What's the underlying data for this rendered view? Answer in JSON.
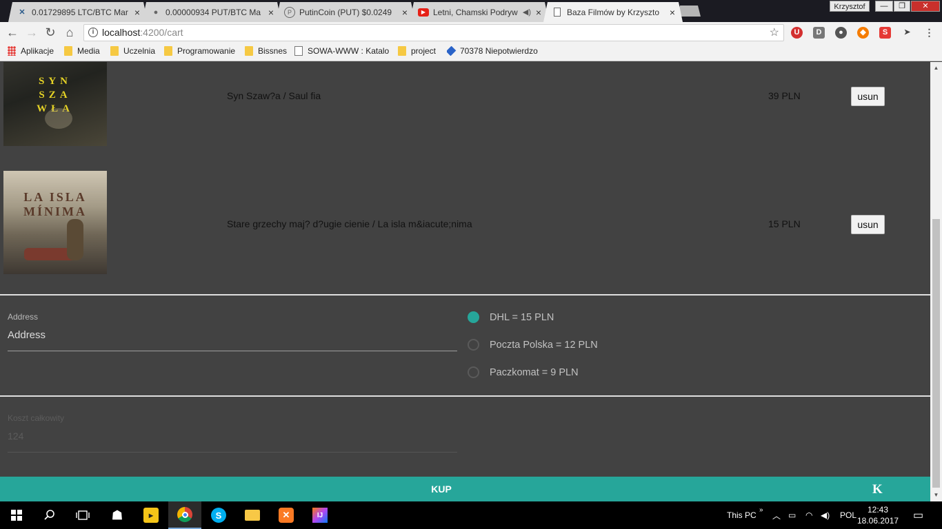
{
  "browser": {
    "tabs": [
      {
        "title": "0.01729895 LTC/BTC Mar",
        "icon": "exchange-x-icon"
      },
      {
        "title": "0.00000934 PUT/BTC Ma",
        "icon": "bubbles-icon"
      },
      {
        "title": "PutinCoin (PUT) $0.0249",
        "icon": "coin-icon"
      },
      {
        "title": "Letni, Chamski Podryw",
        "icon": "youtube-icon"
      },
      {
        "title": "Baza Filmów by Krzyszto",
        "icon": "page-icon"
      }
    ],
    "profile_name": "Krzysztof",
    "url_host": "localhost",
    "url_path": ":4200/cart",
    "bookmarks": [
      {
        "label": "Aplikacje"
      },
      {
        "label": "Media"
      },
      {
        "label": "Uczelnia"
      },
      {
        "label": "Programowanie"
      },
      {
        "label": "Bissnes"
      },
      {
        "label": "SOWA-WWW : Katalo"
      },
      {
        "label": "project"
      },
      {
        "label": "70378 Niepotwierdzo"
      }
    ]
  },
  "cart": {
    "items": [
      {
        "title": "Syn Szaw?a / Saul fia",
        "price": "39 PLN",
        "remove_label": "usun",
        "poster_text": "SYN SZA WŁA"
      },
      {
        "title": "Stare grzechy maj? d?ugie cienie / La isla m&iacute;nima",
        "price": "15 PLN",
        "remove_label": "usun",
        "poster_text": "LA ISLA MÍNIMA"
      }
    ]
  },
  "checkout": {
    "address_label": "Address",
    "address_value": "Address",
    "shipping_options": [
      {
        "label": "DHL = 15 PLN",
        "selected": true
      },
      {
        "label": "Poczta Polska = 12 PLN",
        "selected": false
      },
      {
        "label": "Paczkomat = 9 PLN",
        "selected": false
      }
    ],
    "total_label": "Koszt całkowity",
    "total_value": "124",
    "buy_label": "KUP",
    "logo_letter": "K"
  },
  "taskbar": {
    "this_pc": "This PC",
    "language": "POL",
    "time": "12:43",
    "date": "18.06.2017"
  },
  "colors": {
    "accent": "#26a69a",
    "page_bg": "#424242"
  }
}
